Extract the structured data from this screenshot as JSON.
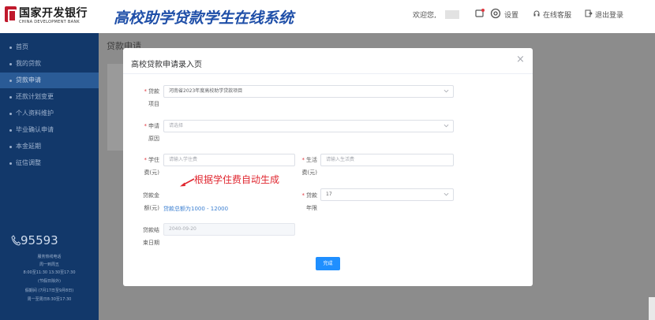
{
  "header": {
    "logo_cn": "国家开发银行",
    "logo_en": "CHINA DEVELOPMENT BANK",
    "system_title": "高校助学贷款学生在线系统",
    "welcome": "欢迎您,",
    "settings": "设置",
    "online_service": "在线客服",
    "logout": "退出登录"
  },
  "sidebar": {
    "items": [
      {
        "label": "首页"
      },
      {
        "label": "我的贷款"
      },
      {
        "label": "贷款申请"
      },
      {
        "label": "还款计划变更"
      },
      {
        "label": "个人资料维护"
      },
      {
        "label": "毕业确认申请"
      },
      {
        "label": "本金延期"
      },
      {
        "label": "征信调整"
      }
    ],
    "hotline": {
      "number": "95593",
      "lines": [
        "服务热线电话",
        "周一到周五",
        "8:00至11:30 13:30至17:30",
        "(节假日除外)",
        "假期间 (7月17日至9月8日)",
        "周一至周日8:30至17:30"
      ]
    }
  },
  "page": {
    "title": "贷款申请"
  },
  "modal": {
    "title": "高校贷款申请录入页",
    "close": "×",
    "fields": {
      "project": {
        "label_1": "贷款",
        "label_2": "项目",
        "value": "河南省2023年度高校助学贷款项目"
      },
      "reason": {
        "label_1": "申请",
        "label_2": "原因",
        "placeholder": "请选择"
      },
      "tuition": {
        "label_1": "学住",
        "label_2": "费(元)",
        "placeholder": "请输入学住费"
      },
      "living": {
        "label_1": "生活",
        "label_2": "费(元)",
        "placeholder": "请输入生活费"
      },
      "amount": {
        "label_1": "贷款金",
        "label_2": "额(元)",
        "hint": "贷款总额为1000 - 12000"
      },
      "term": {
        "label_1": "贷款",
        "label_2": "年限",
        "value": "17"
      },
      "end_date": {
        "label_1": "贷款结",
        "label_2": "束日期",
        "value": "2040-09-20"
      }
    },
    "confirm": "完成"
  },
  "annotation": {
    "text": "根据学住费自动生成"
  },
  "colors": {
    "sidebar_bg": "#12386a",
    "title_blue": "#1f4fa8",
    "primary": "#1f8fff",
    "required": "#e0373f",
    "annotation": "#e0262f"
  }
}
